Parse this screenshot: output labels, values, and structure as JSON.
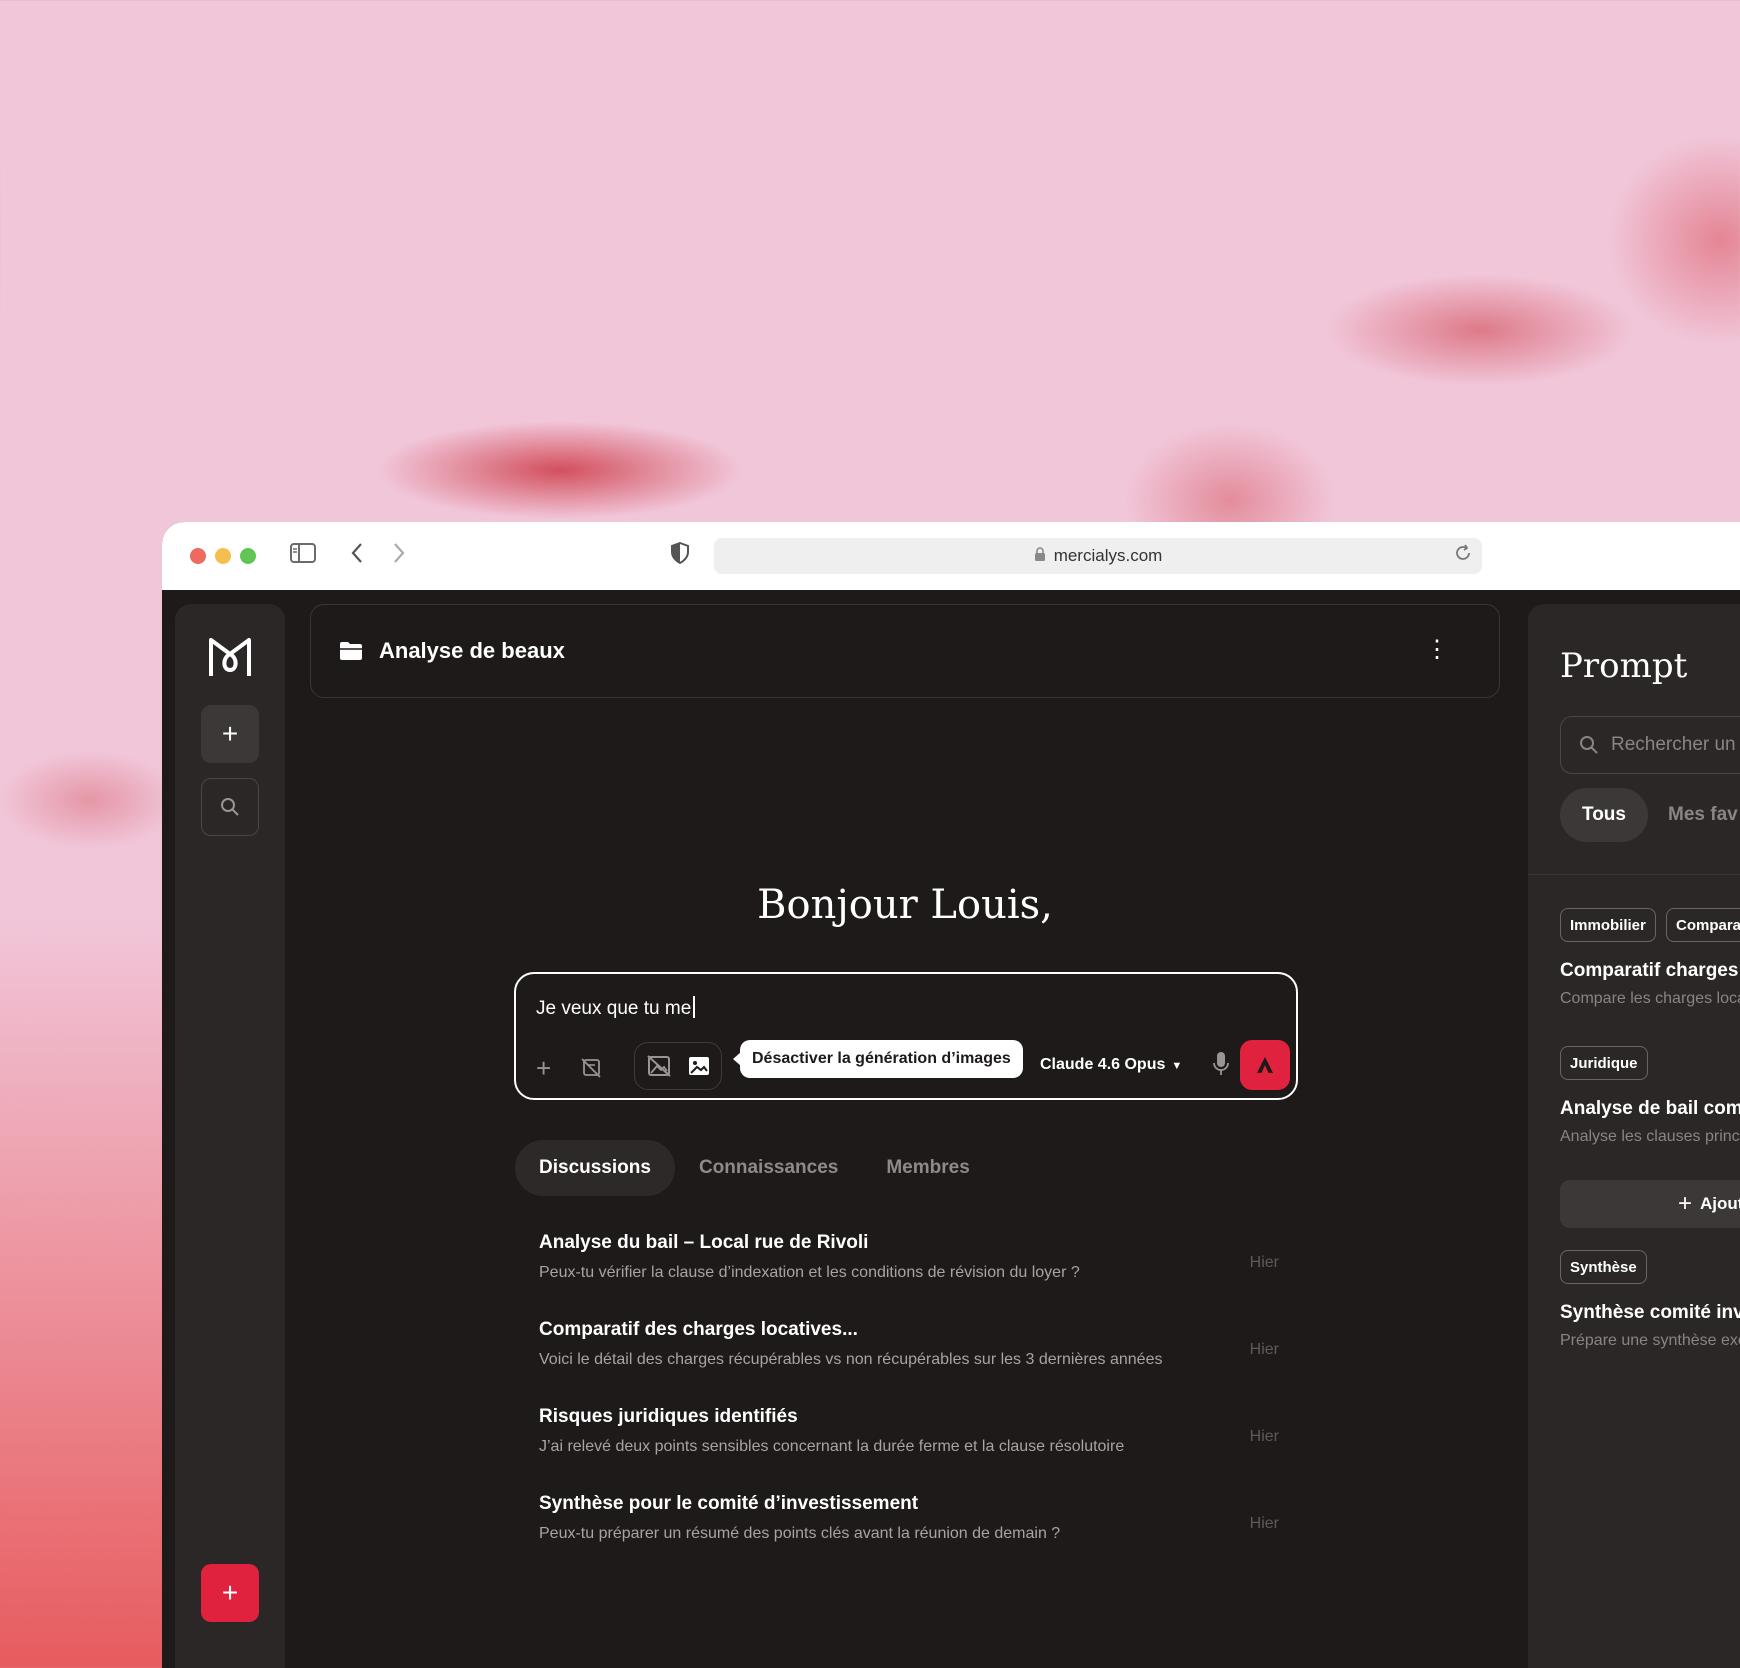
{
  "browser": {
    "url": "mercialys.com"
  },
  "sidebar": {
    "new_label": "+",
    "fab_label": "+"
  },
  "header": {
    "title": "Analyse de beaux",
    "more": "⋮"
  },
  "greeting": "Bonjour Louis,",
  "composer": {
    "text": "Je veux que tu me",
    "tooltip": "Désactiver la génération d’images",
    "model": "Claude 4.6 Opus",
    "add_label": "+"
  },
  "tabs": [
    {
      "label": "Discussions",
      "active": true
    },
    {
      "label": "Connaissances",
      "active": false
    },
    {
      "label": "Membres",
      "active": false
    }
  ],
  "discussions": [
    {
      "title": "Analyse du bail – Local rue de Rivoli",
      "subtitle": "Peux-tu vérifier la clause d’indexation et les conditions de révision du loyer ?",
      "date": "Hier"
    },
    {
      "title": "Comparatif des charges locatives...",
      "subtitle": "Voici le détail des charges récupérables vs non récupérables sur les 3 dernières années",
      "date": "Hier"
    },
    {
      "title": "Risques juridiques identifiés",
      "subtitle": "J’ai relevé deux points sensibles concernant la durée ferme et la clause résolutoire",
      "date": "Hier"
    },
    {
      "title": "Synthèse pour le comité d’investissement",
      "subtitle": "Peux-tu préparer un résumé des points clés avant la réunion de demain ?",
      "date": "Hier"
    }
  ],
  "prompt_panel": {
    "title": "Prompt",
    "search_placeholder": "Rechercher un p",
    "filters": [
      "Tous",
      "Mes fav"
    ],
    "items": [
      {
        "tags": [
          "Immobilier",
          "Compara"
        ],
        "title": "Comparatif charges lo",
        "subtitle": "Compare les charges loca"
      },
      {
        "tags": [
          "Juridique"
        ],
        "title": "Analyse de bail comm",
        "subtitle": "Analyse les clauses princi"
      },
      {
        "tags": [
          "Synthèse"
        ],
        "title": "Synthèse comité inve",
        "subtitle": "Prépare une synthèse exé"
      }
    ],
    "add_label": "Ajout"
  },
  "colors": {
    "accent": "#e0223f",
    "background": "#1d1a19",
    "panel": "#2a2726"
  },
  "icons": {
    "sidebar_toggle": "sidebar-toggle-icon",
    "shield": "shield-icon",
    "lock": "lock-icon",
    "reload": "reload-icon",
    "folder": "folder-icon",
    "search": "search-icon",
    "mic": "microphone-icon",
    "send": "send-icon"
  }
}
